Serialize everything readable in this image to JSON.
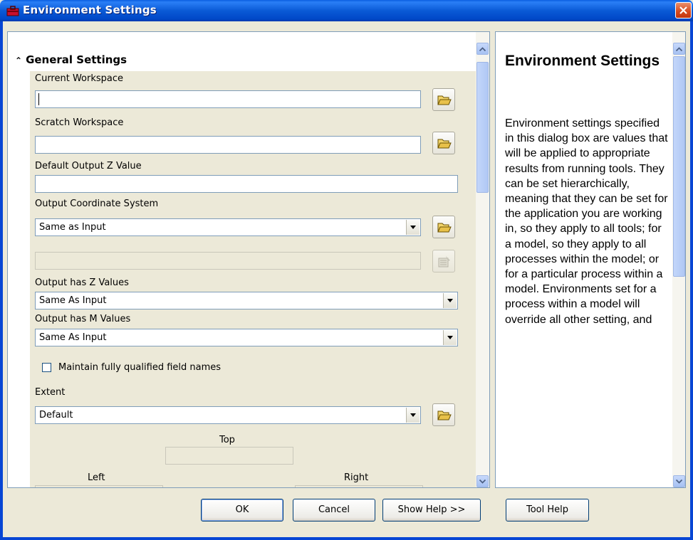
{
  "window": {
    "title": "Environment Settings"
  },
  "section": {
    "title": "General Settings"
  },
  "fields": {
    "current_workspace": {
      "label": "Current Workspace",
      "value": ""
    },
    "scratch_workspace": {
      "label": "Scratch Workspace",
      "value": ""
    },
    "default_z": {
      "label": "Default Output Z Value",
      "value": ""
    },
    "coord_system": {
      "label": "Output Coordinate System",
      "value": "Same as Input"
    },
    "has_z": {
      "label": "Output has Z Values",
      "value": "Same As Input"
    },
    "has_m": {
      "label": "Output has M Values",
      "value": "Same As Input"
    },
    "qualified": {
      "label": "Maintain fully qualified field names",
      "checked": false
    },
    "extent": {
      "label": "Extent",
      "value": "Default"
    },
    "extent_top": {
      "label": "Top",
      "value": ""
    },
    "extent_left": {
      "label": "Left",
      "value": ""
    },
    "extent_right": {
      "label": "Right",
      "value": ""
    }
  },
  "help": {
    "title": "Environment Settings",
    "body": "Environment settings specified in this dialog box are values that will be applied to appropriate results from running tools. They can be set hierarchically, meaning that they can be set for the application you are working in, so they apply to all tools; for a model, so they apply to all processes within the model; or for a particular process within a model. Environments set for a process within a model will override all other setting, and"
  },
  "buttons": {
    "ok": "OK",
    "cancel": "Cancel",
    "show_help": "Show Help >>",
    "tool_help": "Tool Help"
  },
  "icons": {
    "app": "toolbox-icon",
    "browse": "open-folder-icon",
    "properties": "spatial-reference-properties-icon",
    "close": "close-icon"
  },
  "colors": {
    "titlebar": "#0a5ad6",
    "dialog_bg": "#ece9d8",
    "close": "#d6481c"
  }
}
